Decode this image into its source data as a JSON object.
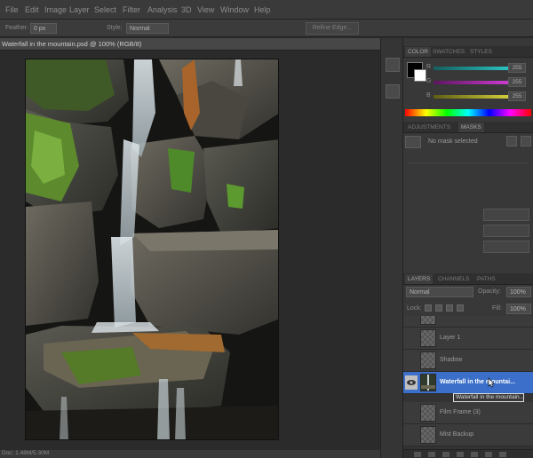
{
  "menu": {
    "items": [
      "File",
      "Edit",
      "Image",
      "Layer",
      "Select",
      "Filter",
      "Analysis",
      "3D",
      "View",
      "Window",
      "Help"
    ]
  },
  "options": {
    "feather_label": "Feather:",
    "feather_value": "0 px",
    "style_label": "Style:",
    "style_value": "Normal",
    "refine_edge_label": "Refine Edge..."
  },
  "document": {
    "tab_title": "Waterfall in the mountain.psd @ 100% (RGB/8)",
    "status_text": "Doc: 1.48M/5.30M"
  },
  "color_panel": {
    "tabs": [
      "COLOR",
      "SWATCHES",
      "STYLES"
    ],
    "channels": [
      {
        "label": "R",
        "value": "255",
        "track_color": "#20a0a0"
      },
      {
        "label": "G",
        "value": "255",
        "track_color": "#b030b0"
      },
      {
        "label": "B",
        "value": "255",
        "track_color": "#b0b020"
      }
    ]
  },
  "masks_panel": {
    "tabs": [
      "ADJUSTMENTS",
      "MASKS"
    ],
    "status": "No mask selected"
  },
  "layers_panel": {
    "tabs": [
      "LAYERS",
      "CHANNELS",
      "PATHS"
    ],
    "blend_mode": "Normal",
    "opacity_label": "Opacity:",
    "opacity_value": "100%",
    "lock_label": "Lock:",
    "fill_label": "Fill:",
    "fill_value": "100%",
    "layers": [
      {
        "name": "Layer 1",
        "selected": false
      },
      {
        "name": "Shadow",
        "selected": false
      },
      {
        "name": "Waterfall in the mountai...",
        "selected": true
      },
      {
        "name": "Film Frame (3)",
        "selected": false
      },
      {
        "name": "Mist Backup",
        "selected": false
      }
    ],
    "tooltip": "Waterfall in the mountain..."
  },
  "colors": {
    "accent": "#3b6fc9",
    "panel_bg": "#383838",
    "canvas_bg": "#2b2b2b"
  }
}
